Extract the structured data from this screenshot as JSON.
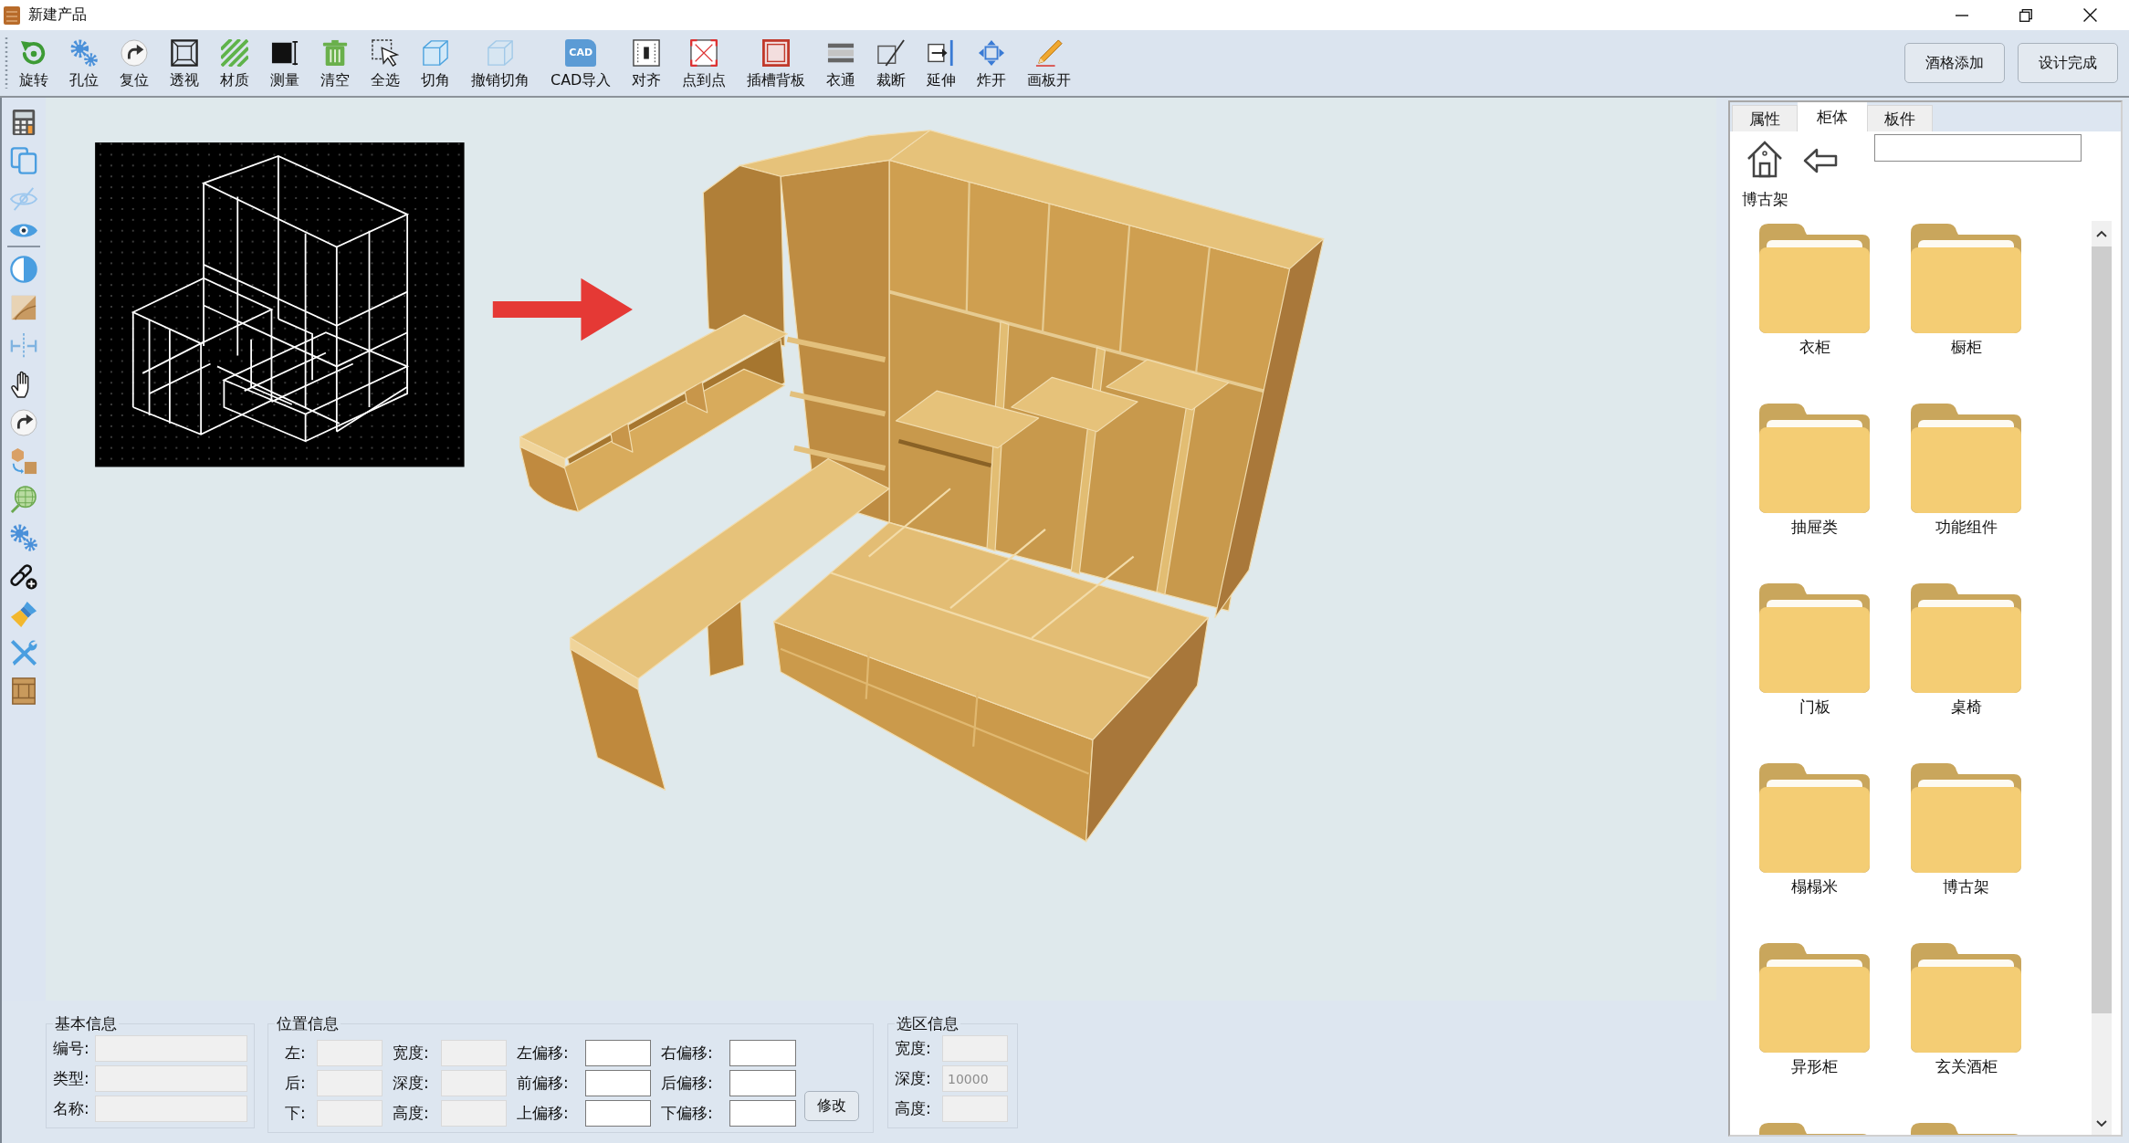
{
  "window": {
    "title": "新建产品"
  },
  "toolbar": {
    "tools": [
      {
        "label": "旋转",
        "disabled": false
      },
      {
        "label": "孔位",
        "disabled": false
      },
      {
        "label": "复位",
        "disabled": false
      },
      {
        "label": "透视",
        "disabled": false
      },
      {
        "label": "材质",
        "disabled": false
      },
      {
        "label": "测量",
        "disabled": false
      },
      {
        "label": "清空",
        "disabled": false
      },
      {
        "label": "全选",
        "disabled": false
      },
      {
        "label": "切角",
        "disabled": false
      },
      {
        "label": "撤销切角",
        "disabled": true
      },
      {
        "label": "CAD导入",
        "tag": "CAD",
        "disabled": false
      },
      {
        "label": "对齐",
        "disabled": false
      },
      {
        "label": "点到点",
        "disabled": false
      },
      {
        "label": "插槽背板",
        "disabled": false
      },
      {
        "label": "衣通",
        "disabled": false
      },
      {
        "label": "裁断",
        "disabled": false
      },
      {
        "label": "延伸",
        "disabled": false
      },
      {
        "label": "炸开",
        "disabled": false
      },
      {
        "label": "画板开",
        "disabled": false
      }
    ],
    "buttons": [
      {
        "label": "酒格添加"
      },
      {
        "label": "设计完成"
      }
    ]
  },
  "info_panel": {
    "groups": [
      {
        "title": "基本信息",
        "kind": "basic",
        "fields": [
          {
            "label": "编号:",
            "disabled": true
          },
          {
            "label": "类型:",
            "disabled": true
          },
          {
            "label": "名称:",
            "disabled": true
          }
        ]
      },
      {
        "title": "位置信息",
        "kind": "position",
        "fields": [
          {
            "label": "左:",
            "disabled": true
          },
          {
            "label": "宽度:",
            "disabled": true
          },
          {
            "label": "左偏移:",
            "disabled": false
          },
          {
            "label": "右偏移:",
            "disabled": false
          },
          {
            "label": "后:",
            "disabled": true
          },
          {
            "label": "深度:",
            "disabled": true
          },
          {
            "label": "前偏移:",
            "disabled": false
          },
          {
            "label": "后偏移:",
            "disabled": false
          },
          {
            "label": "下:",
            "disabled": true
          },
          {
            "label": "高度:",
            "disabled": true
          },
          {
            "label": "上偏移:",
            "disabled": false
          },
          {
            "label": "下偏移:",
            "disabled": false
          }
        ],
        "button": "修改"
      },
      {
        "title": "选区信息",
        "kind": "selection",
        "fields": [
          {
            "label": "宽度:",
            "disabled": true
          },
          {
            "label": "深度:",
            "value": "10000",
            "disabled": true
          },
          {
            "label": "高度:",
            "disabled": true
          }
        ]
      }
    ]
  },
  "library_panel": {
    "tabs": [
      {
        "label": "属性",
        "selected": false
      },
      {
        "label": "柜体",
        "selected": true
      },
      {
        "label": "板件",
        "selected": false
      }
    ],
    "breadcrumb": "博古架",
    "folders": [
      {
        "label": "衣柜",
        "cut_off": false
      },
      {
        "label": "橱柜",
        "cut_off": false
      },
      {
        "label": "抽屉类",
        "cut_off": false
      },
      {
        "label": "功能组件",
        "cut_off": false
      },
      {
        "label": "门板",
        "cut_off": false
      },
      {
        "label": "桌椅",
        "cut_off": false
      },
      {
        "label": "榻榻米",
        "cut_off": false
      },
      {
        "label": "博古架",
        "cut_off": false
      },
      {
        "label": "异形柜",
        "cut_off": false
      },
      {
        "label": "玄关酒柜",
        "cut_off": false
      },
      {
        "cut_off": true
      },
      {
        "cut_off": true
      }
    ]
  }
}
